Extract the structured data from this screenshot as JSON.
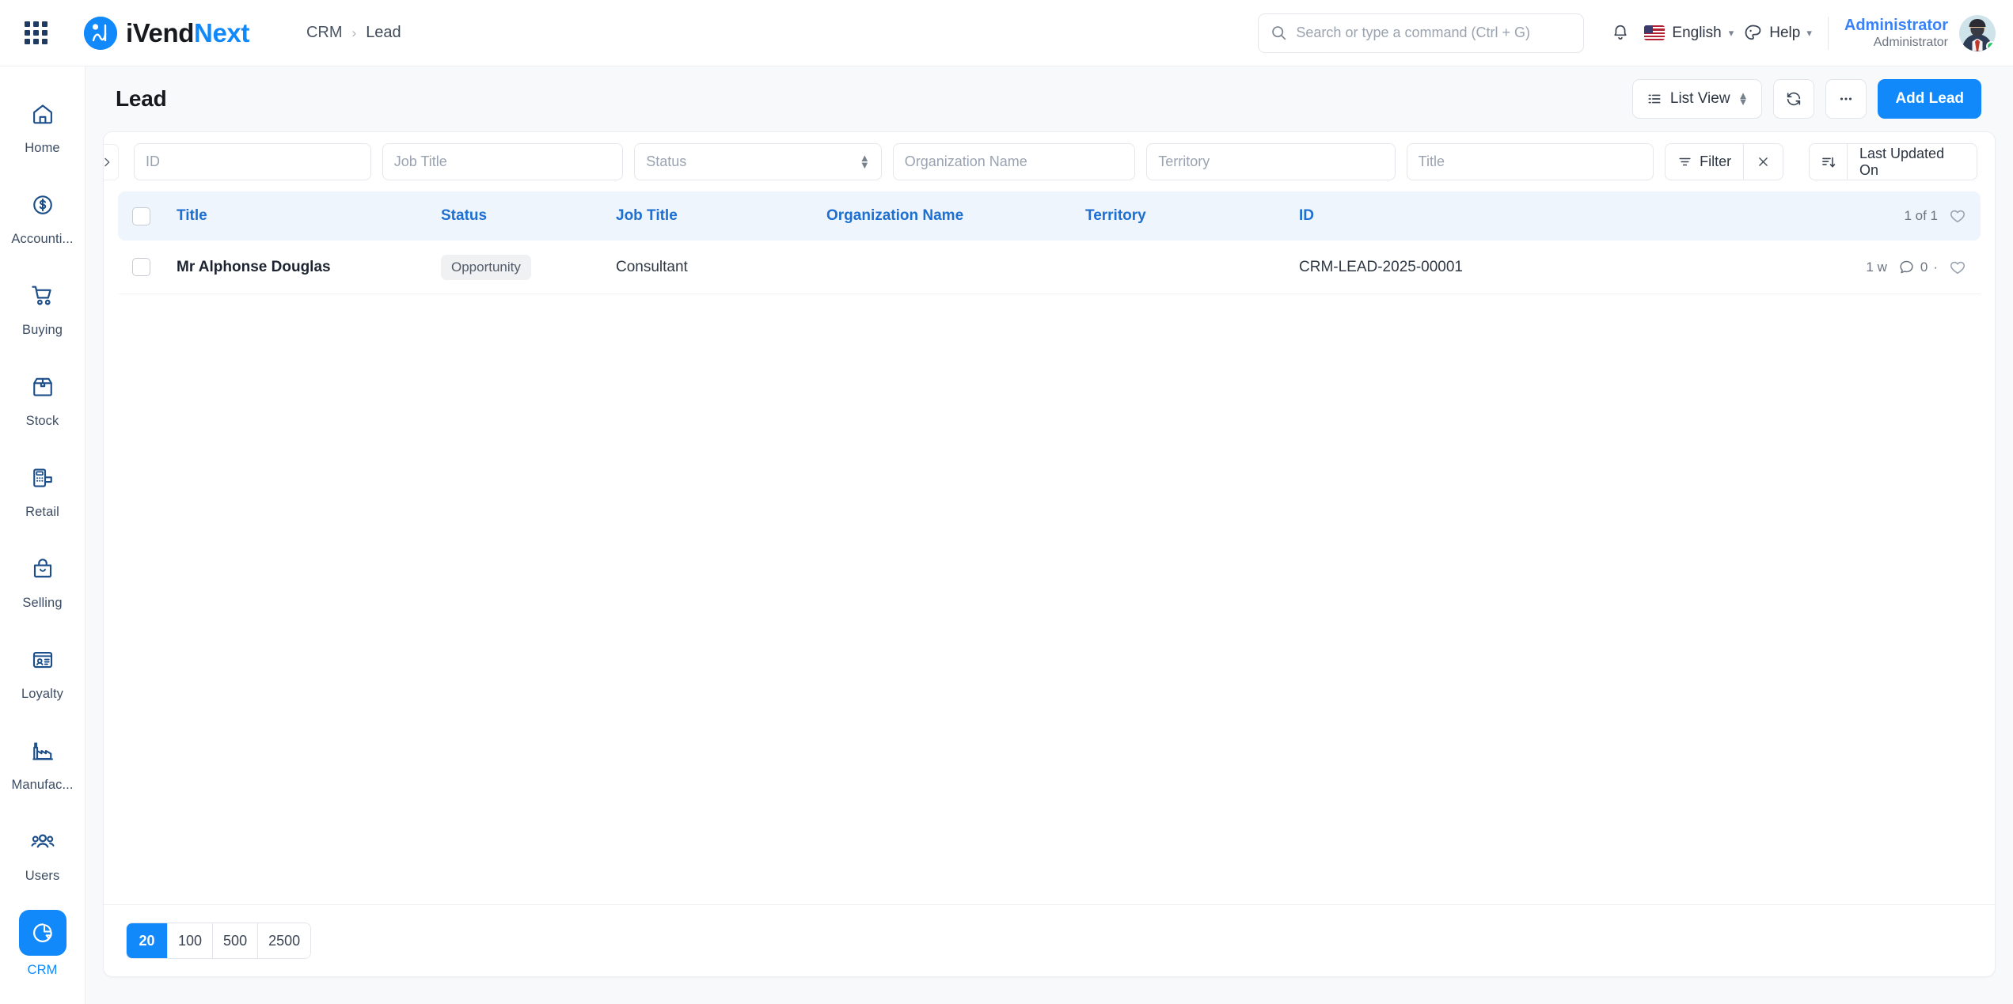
{
  "app": {
    "brand_first": "iVend",
    "brand_second": "Next",
    "apps_icon": "grid-apps-icon"
  },
  "breadcrumb": {
    "parent": "CRM",
    "separator": "›",
    "current": "Lead"
  },
  "header": {
    "search_placeholder": "Search or type a command (Ctrl + G)",
    "search_value": "",
    "notifications_icon": "bell-icon",
    "language": "English",
    "help": "Help",
    "theme_icon": "palette-icon",
    "user_name": "Administrator",
    "user_role": "Administrator",
    "presence": "online"
  },
  "sidebar": {
    "items": [
      {
        "label": "Home",
        "icon": "home-icon",
        "active": false
      },
      {
        "label": "Accounti...",
        "icon": "dollar-circle-icon",
        "active": false
      },
      {
        "label": "Buying",
        "icon": "shopping-cart-icon",
        "active": false
      },
      {
        "label": "Stock",
        "icon": "box-icon",
        "active": false
      },
      {
        "label": "Retail",
        "icon": "pos-terminal-icon",
        "active": false
      },
      {
        "label": "Selling",
        "icon": "shopping-bag-icon",
        "active": false
      },
      {
        "label": "Loyalty",
        "icon": "id-card-icon",
        "active": false
      },
      {
        "label": "Manufac...",
        "icon": "factory-icon",
        "active": false
      },
      {
        "label": "Users",
        "icon": "users-group-icon",
        "active": false
      },
      {
        "label": "CRM",
        "icon": "pie-chart-icon",
        "active": true
      }
    ]
  },
  "page": {
    "title": "Lead",
    "view_label": "List View",
    "view_icon": "list-icon",
    "refresh_icon": "refresh-icon",
    "more_icon": "ellipsis-icon",
    "add_label": "Add Lead"
  },
  "filters": {
    "expander_icon": "chevron-right-icon",
    "id_placeholder": "ID",
    "id_value": "",
    "job_title_placeholder": "Job Title",
    "job_title_value": "",
    "status_placeholder": "Status",
    "status_value": "",
    "organization_placeholder": "Organization Name",
    "organization_value": "",
    "territory_placeholder": "Territory",
    "territory_value": "",
    "title_placeholder": "Title",
    "title_value": "",
    "filter_label": "Filter",
    "filter_icon": "filter-icon",
    "clear_icon": "close-icon",
    "sort_icon": "sort-descending-icon",
    "sort_label": "Last Updated On"
  },
  "table": {
    "columns": [
      "Title",
      "Status",
      "Job Title",
      "Organization Name",
      "Territory",
      "ID"
    ],
    "count_label": "1 of 1",
    "like_icon": "heart-icon",
    "rows": [
      {
        "title": "Mr Alphonse Douglas",
        "status": "Opportunity",
        "job_title": "Consultant",
        "organization_name": "",
        "territory": "",
        "id": "CRM-LEAD-2025-00001",
        "modified": "1 w",
        "comments": "0",
        "separator": "·"
      }
    ]
  },
  "pagination": {
    "options": [
      "20",
      "100",
      "500",
      "2500"
    ],
    "selected": "20"
  },
  "colors": {
    "accent": "#1289fb",
    "header_row": "#eef5fd",
    "column_header_text": "#1d6fd0",
    "badge_bg": "#f0f1f3",
    "presence_green": "#2bc96a"
  }
}
